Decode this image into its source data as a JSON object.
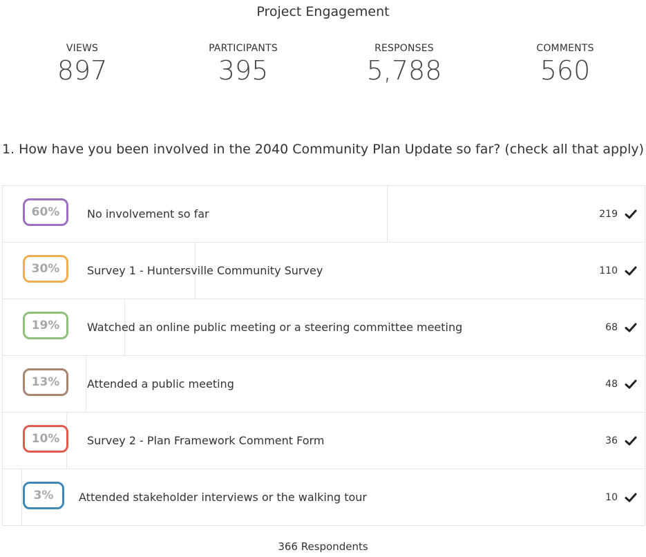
{
  "page": {
    "title": "Project Engagement"
  },
  "stats": [
    {
      "label": "VIEWS",
      "value": "897"
    },
    {
      "label": "PARTICIPANTS",
      "value": "395"
    },
    {
      "label": "RESPONSES",
      "value": "5,788"
    },
    {
      "label": "COMMENTS",
      "value": "560"
    }
  ],
  "question": {
    "text": "1. How have you been involved in the 2040 Community Plan Update so far? (check all that apply)"
  },
  "options": [
    {
      "percent_label": "60%",
      "percent": 60,
      "label": "No involvement so far",
      "count": "219",
      "color": "#9b6fbf",
      "icon": "check-icon"
    },
    {
      "percent_label": "30%",
      "percent": 30,
      "label": "Survey 1 - Huntersville Community Survey",
      "count": "110",
      "color": "#f0ad4e",
      "icon": "check-icon"
    },
    {
      "percent_label": "19%",
      "percent": 19,
      "label": "Watched an online public meeting or a steering committee meeting",
      "count": "68",
      "color": "#8dc07a",
      "icon": "check-icon"
    },
    {
      "percent_label": "13%",
      "percent": 13,
      "label": "Attended a public meeting",
      "count": "48",
      "color": "#a88473",
      "icon": "check-icon"
    },
    {
      "percent_label": "10%",
      "percent": 10,
      "label": "Survey 2 - Plan Framework Comment Form",
      "count": "36",
      "color": "#e15a4c",
      "icon": "check-icon"
    },
    {
      "percent_label": "3%",
      "percent": 3,
      "label": "Attended stakeholder interviews or the walking tour",
      "count": "10",
      "color": "#3d88b8",
      "icon": "check-icon"
    }
  ],
  "footer": {
    "respondents": "366 Respondents"
  }
}
